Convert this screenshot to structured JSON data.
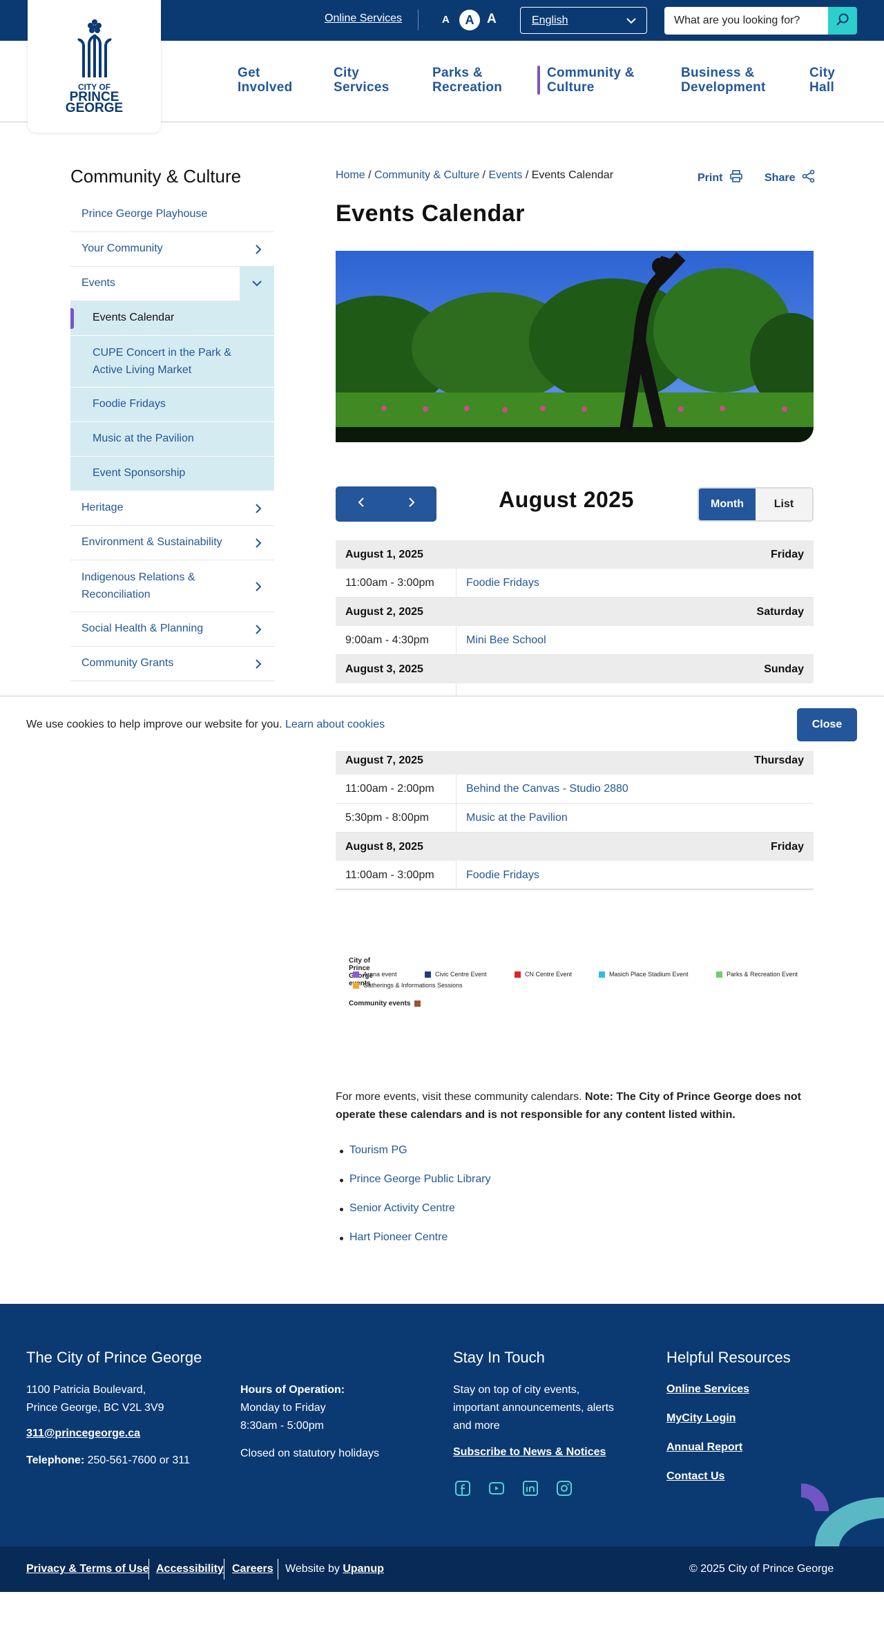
{
  "topbar": {
    "online_services": "Online Services",
    "font_small": "A",
    "font_medium": "A",
    "font_large": "A",
    "language": "English",
    "search_placeholder": "What are you looking for?"
  },
  "logo": {
    "line1": "CITY OF",
    "line2": "PRINCE",
    "line3": "GEORGE"
  },
  "nav": [
    {
      "l1": "Get",
      "l2": "Involved"
    },
    {
      "l1": "City",
      "l2": "Services"
    },
    {
      "l1": "Parks &",
      "l2": "Recreation"
    },
    {
      "l1": "Community &",
      "l2": "Culture"
    },
    {
      "l1": "Business &",
      "l2": "Development"
    },
    {
      "l1": "City",
      "l2": "Hall"
    }
  ],
  "sidebar": {
    "title": "Community & Culture",
    "items": [
      "Prince George Playhouse",
      "Your Community",
      "Events",
      "Events Calendar",
      "CUPE Concert in the Park & Active Living Market",
      "Foodie Fridays",
      "Music at the Pavilion",
      "Event Sponsorship",
      "Heritage",
      "Environment & Sustainability",
      "Indigenous Relations & Reconciliation",
      "Social Health & Planning",
      "Community Grants"
    ]
  },
  "breadcrumb": {
    "home": "Home",
    "section": "Community & Culture",
    "sub": "Events",
    "current": "Events Calendar",
    "sep": "/"
  },
  "utility": {
    "print": "Print",
    "share": "Share"
  },
  "page_title": "Events Calendar",
  "calendar": {
    "month": "August 2025",
    "view_month": "Month",
    "view_list": "List",
    "days": [
      {
        "date": "August 1, 2025",
        "weekday": "Friday",
        "events": [
          {
            "time": "11:00am - 3:00pm",
            "title": "Foodie Fridays"
          }
        ]
      },
      {
        "date": "August 2, 2025",
        "weekday": "Saturday",
        "events": [
          {
            "time": "9:00am - 4:30pm",
            "title": "Mini Bee School"
          }
        ]
      },
      {
        "date": "August 3, 2025",
        "weekday": "Sunday",
        "events": []
      },
      {
        "date": "August 7, 2025",
        "weekday": "Thursday",
        "events": [
          {
            "time": "11:00am - 2:00pm",
            "title": "Behind the Canvas - Studio 2880"
          },
          {
            "time": "5:30pm - 8:00pm",
            "title": "Music at the Pavilion"
          }
        ]
      },
      {
        "date": "August 8, 2025",
        "weekday": "Friday",
        "events": [
          {
            "time": "11:00am - 3:00pm",
            "title": "Foodie Fridays"
          }
        ]
      }
    ]
  },
  "cookie": {
    "text": "We use cookies to help improve our website for you.",
    "link": "Learn about cookies",
    "close": "Close"
  },
  "legend": {
    "city_title": "City of Prince George events",
    "items": [
      {
        "label": "Arena event",
        "color": "#8a5cd6"
      },
      {
        "label": "Civic Centre Event",
        "color": "#1e3c8c"
      },
      {
        "label": "CN Centre Event",
        "color": "#e02424"
      },
      {
        "label": "Masich Place Stadium Event",
        "color": "#37b8e8"
      },
      {
        "label": "Parks & Recreation Event",
        "color": "#6fcf6f"
      },
      {
        "label": "Gatherings & Informations Sessions",
        "color": "#f2a92b"
      }
    ],
    "community_title": "Community events",
    "community_color": "#a0522d"
  },
  "more": {
    "text": "For more events, visit these community calendars.",
    "note": "Note: The City of Prince George does not operate these calendars and is not responsible for any content listed within.",
    "links": [
      "Tourism PG",
      "Prince George Public Library",
      "Senior Activity Centre",
      "Hart Pioneer Centre"
    ]
  },
  "footer": {
    "org_title": "The City of Prince George",
    "address1": "1100 Patricia Boulevard,",
    "address2": "Prince George, BC V2L 3V9",
    "email": "311@princegeorge.ca",
    "phone_label": "Telephone:",
    "phone": "250-561-7600 or 311",
    "hours_label": "Hours of Operation:",
    "hours_days": "Monday to Friday",
    "hours_time": "8:30am - 5:00pm",
    "holidays": "Closed on statutory holidays",
    "stay_title": "Stay In Touch",
    "stay_text": "Stay on top of city events, important announcements, alerts and more",
    "subscribe": "Subscribe to News & Notices",
    "resources_title": "Helpful Resources",
    "resources": [
      "Online Services",
      "MyCity Login",
      "Annual Report",
      "Contact Us"
    ]
  },
  "bottom": {
    "privacy": "Privacy & Terms of Use",
    "accessibility": "Accessibility",
    "careers": "Careers",
    "website_by": "Website by",
    "agency": "Upanup",
    "copyright": "© 2025 City of Prince George"
  }
}
